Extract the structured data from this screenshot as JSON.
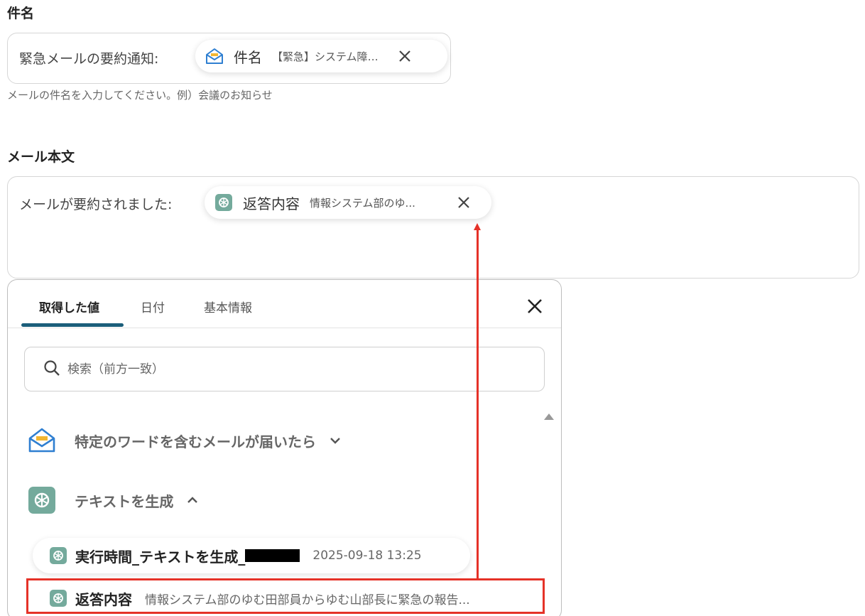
{
  "subject": {
    "label": "件名",
    "prefix": "緊急メールの要約通知:",
    "chip": {
      "name": "件名",
      "value": "【緊急】システム障害...",
      "icon": "email-trigger-icon"
    },
    "hint": "メールの件名を入力してください。例）会議のお知らせ"
  },
  "body": {
    "label": "メール本文",
    "prefix": "メールが要約されました:",
    "chip": {
      "name": "返答内容",
      "value": "情報システム部のゆ...",
      "icon": "openai-icon"
    }
  },
  "picker": {
    "tabs": [
      {
        "label": "取得した値",
        "active": true
      },
      {
        "label": "日付",
        "active": false
      },
      {
        "label": "基本情報",
        "active": false
      }
    ],
    "search_placeholder": "検索（前方一致）",
    "groups": [
      {
        "label": "特定のワードを含むメールが届いたら",
        "icon": "email-trigger-icon",
        "expanded": false
      },
      {
        "label": "テキストを生成",
        "icon": "openai-icon",
        "expanded": true
      }
    ],
    "items": [
      {
        "name": "実行時間_テキストを生成_",
        "value": "2025-09-18 13:25",
        "redacted": true
      },
      {
        "name": "返答内容",
        "value": "情報システム部のゆむ田部員からゆむ山部長に緊急の報告...",
        "highlighted": true
      }
    ]
  },
  "colors": {
    "accent": "#1b5e7a",
    "highlight": "#e53228",
    "openai": "#74aa9c",
    "mail": "#2f7fd1"
  }
}
